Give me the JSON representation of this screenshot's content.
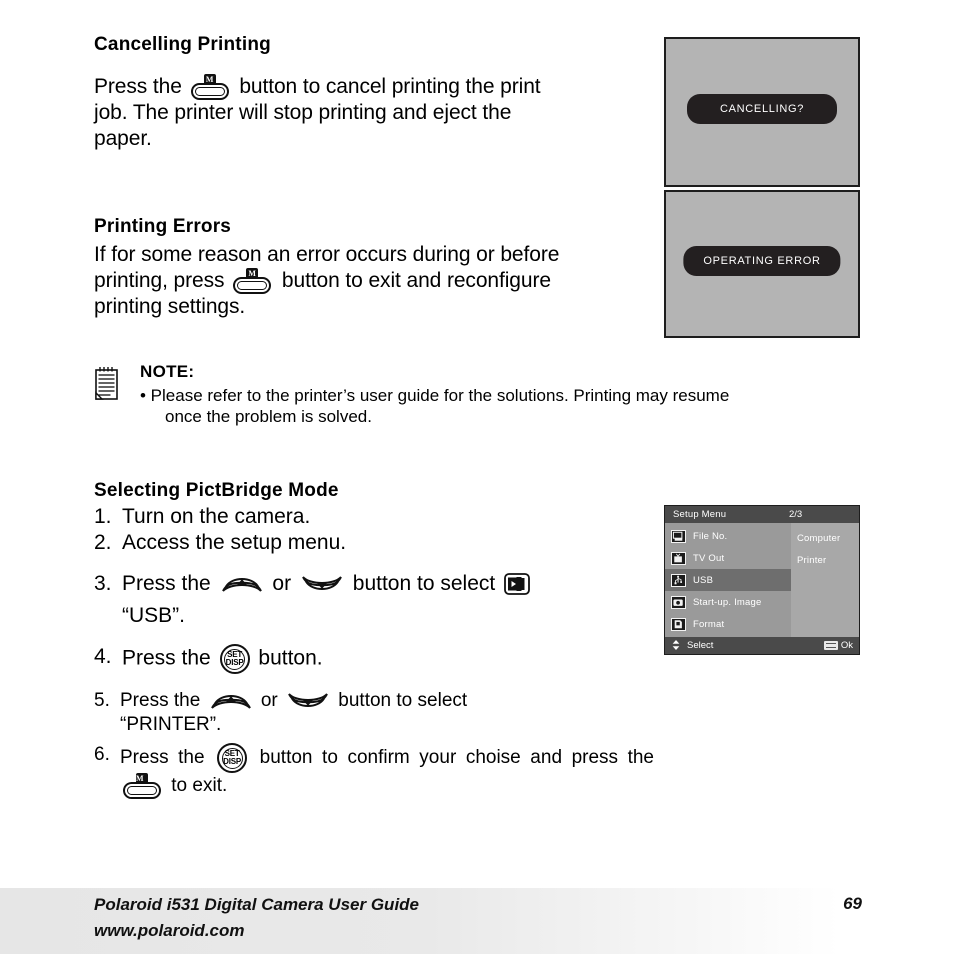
{
  "sections": {
    "cancelling": {
      "heading": "Cancelling Printing",
      "text_a": "Press the",
      "text_b": "button to cancel printing the print job. The printer will stop printing and eject the paper."
    },
    "errors": {
      "heading": "Printing Errors",
      "text_a": "If for some reason an error occurs during or before printing, press",
      "text_b": "button to exit and reconfigure printing settings."
    },
    "note": {
      "title": "NOTE:",
      "bullet": "• Please refer to the printer’s user guide for the solutions. Printing may resume",
      "bullet_cont": "once the problem is solved."
    },
    "pictbridge": {
      "heading": "Selecting PictBridge Mode",
      "steps": [
        {
          "num": "1.",
          "text": "Turn on the camera."
        },
        {
          "num": "2.",
          "text": "Access the setup menu."
        },
        {
          "num": "3.",
          "a": "Press the",
          "b": "or",
          "c": "button to select",
          "d": "“USB”."
        },
        {
          "num": "4.",
          "a": "Press the",
          "b": "button."
        },
        {
          "num": "5.",
          "a": "Press the",
          "b": "or",
          "c": "button to select",
          "d": "“PRINTER”."
        },
        {
          "num": "6.",
          "a": "Press the",
          "b": "button to confirm your choise and press the",
          "c": "to exit."
        }
      ]
    }
  },
  "icons": {
    "menu_button_label": "M",
    "set_top": "SET",
    "set_bottom": "DISP"
  },
  "lcd_cancel": {
    "message": "CANCELLING?"
  },
  "lcd_error": {
    "message": "OPERATING ERROR"
  },
  "setup_menu": {
    "title": "Setup Menu",
    "page": "2/3",
    "items": [
      {
        "label": "File No.",
        "icon": "file-number-icon",
        "selected": false
      },
      {
        "label": "TV Out",
        "icon": "tv-out-icon",
        "selected": false
      },
      {
        "label": "USB",
        "icon": "usb-icon",
        "selected": true
      },
      {
        "label": "Start-up. Image",
        "icon": "startup-image-icon",
        "selected": false
      },
      {
        "label": "Format",
        "icon": "format-card-icon",
        "selected": false
      }
    ],
    "values": [
      "Computer",
      "Printer"
    ],
    "footer_left": "Select",
    "footer_right": "Ok"
  },
  "footer": {
    "line1": "Polaroid i531 Digital Camera User Guide",
    "line2": "www.polaroid.com",
    "page_number": "69"
  }
}
